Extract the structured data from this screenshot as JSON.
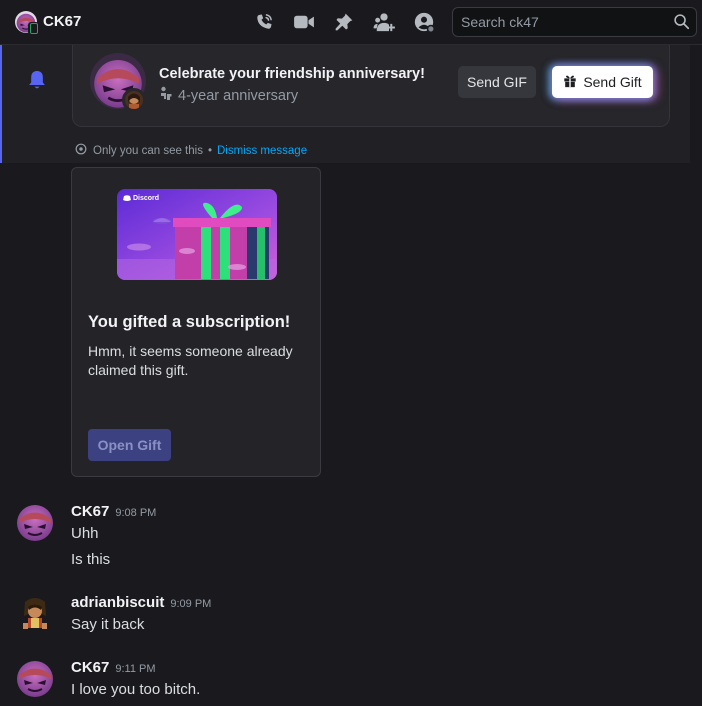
{
  "header": {
    "title": "CK67",
    "search_placeholder": "Search ck47",
    "icons": [
      "voice-call-icon",
      "video-call-icon",
      "pinned-icon",
      "add-friend-icon",
      "profile-icon",
      "search-icon"
    ]
  },
  "anniversary": {
    "title": "Celebrate your friendship anniversary!",
    "subtitle": "4-year anniversary",
    "send_gif": "Send GIF",
    "send_gift": "Send Gift",
    "only_you": "Only you can see this",
    "separator": "•",
    "dismiss": "Dismiss message"
  },
  "gift": {
    "brand": "Discord",
    "title": "You gifted a subscription!",
    "description": "Hmm, it seems someone already claimed this gift.",
    "open_button": "Open Gift"
  },
  "messages": [
    {
      "author": "CK67",
      "time": "9:08 PM",
      "lines": [
        "Uhh",
        "Is this"
      ]
    },
    {
      "author": "adrianbiscuit",
      "time": "9:09 PM",
      "lines": [
        "Say it back"
      ]
    },
    {
      "author": "CK67",
      "time": "9:11 PM",
      "lines": [
        "I love you too bitch."
      ]
    }
  ],
  "colors": {
    "accent": "#5865f2",
    "background": "#1a1a1e",
    "online": "#23a55a",
    "link": "#00a8fc"
  }
}
